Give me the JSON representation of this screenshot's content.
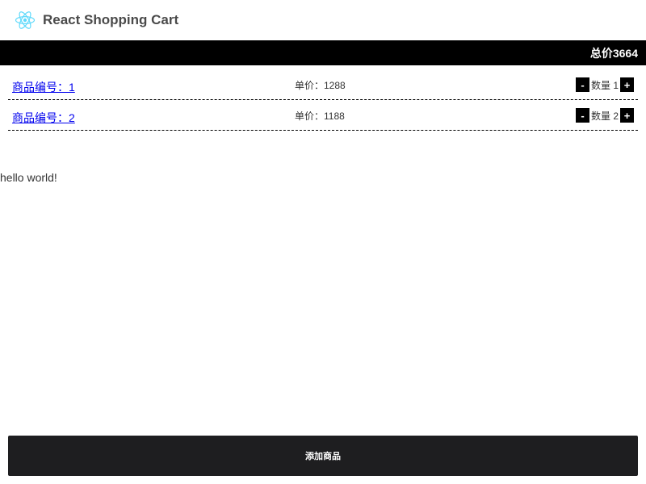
{
  "header": {
    "title": "React Shopping Cart",
    "logo_icon": "react-atom-icon",
    "logo_color": "#61dafb"
  },
  "total": {
    "label": "总价3664"
  },
  "cart": {
    "items": [
      {
        "name": "商品编号：1",
        "price": "单价：1288",
        "quantity": "数量 1",
        "minus_label": "-",
        "plus_label": "+"
      },
      {
        "name": "商品编号：2",
        "price": "单价：1188",
        "quantity": "数量 2",
        "minus_label": "-",
        "plus_label": "+"
      }
    ]
  },
  "content": {
    "hello_text": "hello world!"
  },
  "footer": {
    "add_button_label": "添加商品"
  },
  "colors": {
    "total_bar_bg": "#000000",
    "link": "#0000ee",
    "add_button_bg": "#1e1e20"
  }
}
